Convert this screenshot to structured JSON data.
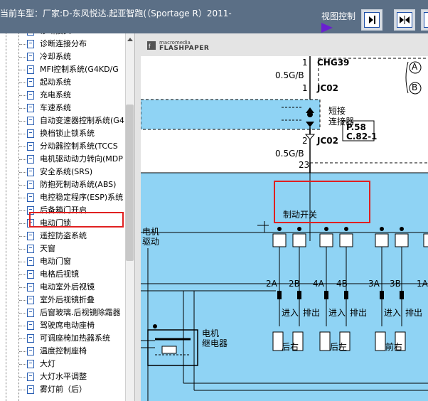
{
  "header": {
    "title": "当前车型：厂家:D-东风悦达.起亚智跑(（Sportage R）2011-",
    "view_control_label": "视图控制",
    "buttons": [
      {
        "icon": "arrow-right-bar-icon"
      },
      {
        "icon": "arrows-inward-icon"
      },
      {
        "icon": "arrows-outward-icon"
      }
    ]
  },
  "sidebar": {
    "selected_index": 11,
    "items": [
      {
        "label": "诊断接头"
      },
      {
        "label": "诊断连接分布"
      },
      {
        "label": "冷却系统"
      },
      {
        "label": "MFI控制系统(G4KD/G"
      },
      {
        "label": "起动系统"
      },
      {
        "label": "充电系统"
      },
      {
        "label": "车速系统"
      },
      {
        "label": "自动变速器控制系统(G4"
      },
      {
        "label": "换档锁止锁系统"
      },
      {
        "label": "分动器控制系统(TCCS"
      },
      {
        "label": "电机驱动动力转向(MDP"
      },
      {
        "label": "安全系统(SRS)"
      },
      {
        "label": "防抱死制动系统(ABS)"
      },
      {
        "label": "电控稳定程序(ESP)系统"
      },
      {
        "label": "后备箱门开启"
      },
      {
        "label": "电动门锁"
      },
      {
        "label": "遥控防盗系统"
      },
      {
        "label": "天窗"
      },
      {
        "label": "电动门窗"
      },
      {
        "label": "电格后视镜"
      },
      {
        "label": "电动室外后视镜"
      },
      {
        "label": "室外后视镜折叠"
      },
      {
        "label": "后窗玻璃.后视镜除霜器"
      },
      {
        "label": "驾驶席电动座椅"
      },
      {
        "label": "可调座椅加热器系统"
      },
      {
        "label": "温度控制座椅"
      },
      {
        "label": "大灯"
      },
      {
        "label": "大灯水平调整"
      },
      {
        "label": "雾灯前（后）"
      }
    ]
  },
  "viewer": {
    "brand_top": "macromedia",
    "brand_main": "FLASHPAPER"
  },
  "diagram": {
    "connector_top": "CHG39",
    "pin_top": "1",
    "wire_top": "0.5G/B",
    "pin_jc02_top": "1",
    "jc02_top": "JC02",
    "circle_a": "A",
    "circle_b": "B",
    "short_connector": "短接\n连接器",
    "pin_jc02_bottom": "2",
    "jc02_bottom": "JC02",
    "ref_page": "P.58",
    "ref_code": "C.82-1",
    "wire_bottom": "0.5G/B",
    "pin_23": "23",
    "brake_switch": "制动开关",
    "motor_drive": "电机\n驱动",
    "motor_relay": "电机\n继电器",
    "pin_labels": [
      "2A",
      "2B",
      "4A",
      "4B",
      "3A",
      "3B",
      "1A"
    ],
    "io_labels": [
      "进入",
      "排出",
      "进入",
      "排出",
      "进入",
      "排出"
    ],
    "wheel_labels": [
      "后右",
      "后左",
      "前右"
    ]
  },
  "colors": {
    "topbar": "#5b6f86",
    "diagram_blue": "#8fd3f4",
    "highlight_red": "#e02020",
    "view_arrow": "#6a1fd0"
  }
}
